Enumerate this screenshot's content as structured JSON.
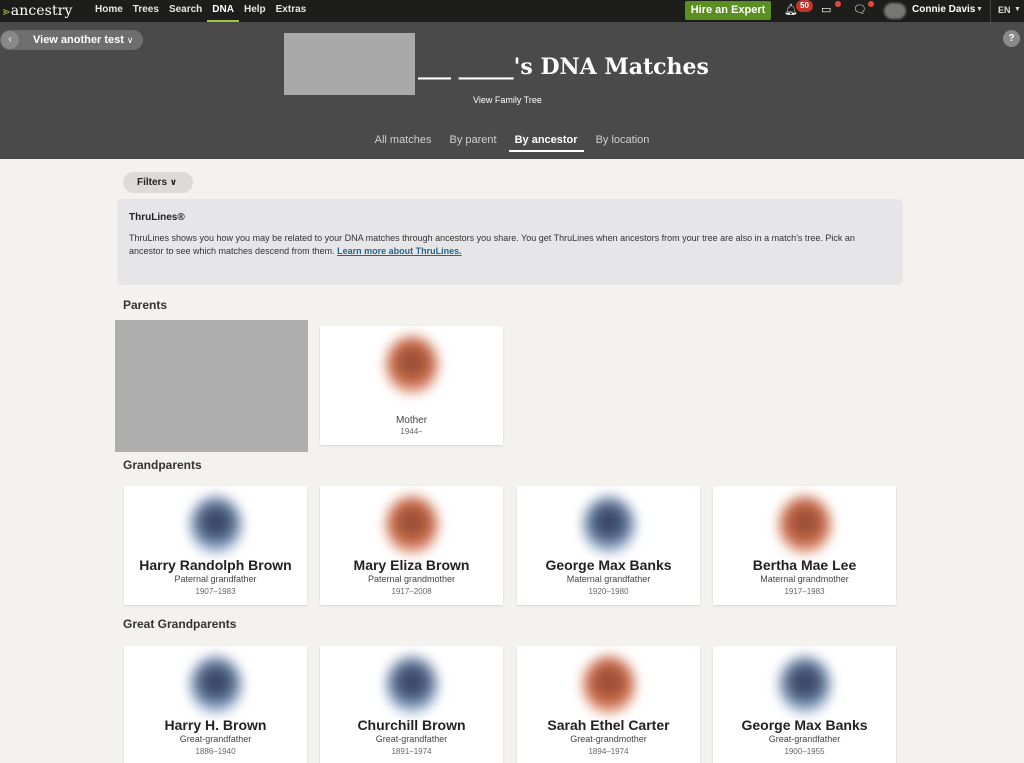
{
  "nav": {
    "logo_text": "ancestry",
    "links": [
      "Home",
      "Trees",
      "Search",
      "DNA",
      "Help",
      "Extras"
    ],
    "active_link": "DNA",
    "hire_button": "Hire an Expert",
    "notification_count": "50",
    "user_name": "Connie Davis",
    "language": "EN",
    "accent_color": "#9fc43a",
    "hire_color": "#5b8f22"
  },
  "header": {
    "back_button": "View another test",
    "title": "___ _____'s DNA Matches",
    "view_family_tree": "View Family Tree",
    "tabs": [
      "All matches",
      "By parent",
      "By ancestor",
      "By location"
    ],
    "active_tab": "By ancestor"
  },
  "filters_label": "Filters",
  "thrulines": {
    "title": "ThruLines®",
    "body": "ThruLines shows you how you may be related to your DNA matches through ancestors you share. You get ThruLines when ancestors from your tree are also in a match's tree. Pick an ancestor to see which matches descend from them.",
    "link": "Learn more about ThruLines."
  },
  "sections": {
    "parents": {
      "title": "Parents",
      "cards": [
        {
          "relation": "Mother",
          "years": "1944–",
          "portrait": "female"
        }
      ]
    },
    "grandparents": {
      "title": "Grandparents",
      "cards": [
        {
          "name": "Harry Randolph Brown",
          "relation": "Paternal grandfather",
          "years": "1907–1983",
          "portrait": "male"
        },
        {
          "name": "Mary Eliza Brown",
          "relation": "Paternal grandmother",
          "years": "1917–2008",
          "portrait": "female"
        },
        {
          "name": "George Max Banks",
          "relation": "Maternal grandfather",
          "years": "1920–1980",
          "portrait": "male"
        },
        {
          "name": "Bertha Mae Lee",
          "relation": "Maternal grandmother",
          "years": "1917–1983",
          "portrait": "female"
        }
      ]
    },
    "great_grandparents": {
      "title": "Great Grandparents",
      "cards": [
        {
          "name": "Harry H. Brown",
          "relation": "Great-grandfather",
          "years": "1886–1940",
          "portrait": "male"
        },
        {
          "name": "Churchill Brown",
          "relation": "Great-grandfather",
          "years": "1891–1974",
          "portrait": "male"
        },
        {
          "name": "Sarah Ethel Carter",
          "relation": "Great-grandmother",
          "years": "1894–1974",
          "portrait": "female"
        },
        {
          "name": "George Max Banks",
          "relation": "Great-grandfather",
          "years": "1900–1955",
          "portrait": "male"
        }
      ]
    }
  }
}
